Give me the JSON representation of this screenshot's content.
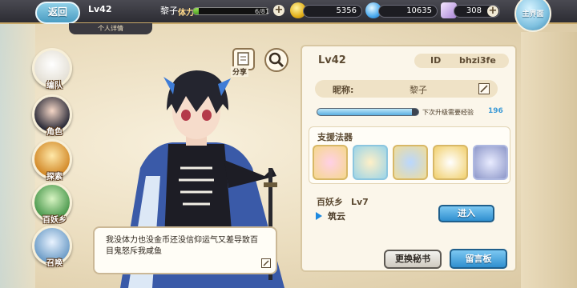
{
  "topbar": {
    "back_label": "返回",
    "level": "Lv42",
    "player_name": "黎子",
    "profile_tab": "个人详情",
    "stamina_label": "体力",
    "stamina_value": "6/81",
    "stamina_fraction": 0.074,
    "gold": "5356",
    "gems": "10635",
    "scrolls": "308",
    "main_label": "主界面"
  },
  "nav": [
    {
      "label": "编队",
      "icon": "formation-icon"
    },
    {
      "label": "角色",
      "icon": "character-icon"
    },
    {
      "label": "探索",
      "icon": "explore-icon"
    },
    {
      "label": "百妖乡",
      "icon": "village-icon"
    },
    {
      "label": "召唤",
      "icon": "summon-icon"
    }
  ],
  "tools": {
    "share_label": "分享"
  },
  "speech": {
    "text": "我没体力也没金币还没信仰运气又差导致百目鬼怒斥我咸鱼"
  },
  "panel": {
    "level": "Lv42",
    "id_label": "ID",
    "id_value": "bhzi3fe",
    "nickname_label": "昵称:",
    "nickname_value": "黎子",
    "exp_label": "下次升级需要经验",
    "exp_needed": "196",
    "exp_fraction": 0.94,
    "support_title": "支援法器",
    "village_label": "百妖乡",
    "village_level": "Lv7",
    "town_name": "筑云",
    "enter_button": "进入",
    "change_secretary": "更换秘书",
    "message_board": "留言板"
  },
  "colors": {
    "accent_blue": "#2f8fcf",
    "panel_bg": "#fbf6ea",
    "slot_gold": "#d8b867"
  }
}
